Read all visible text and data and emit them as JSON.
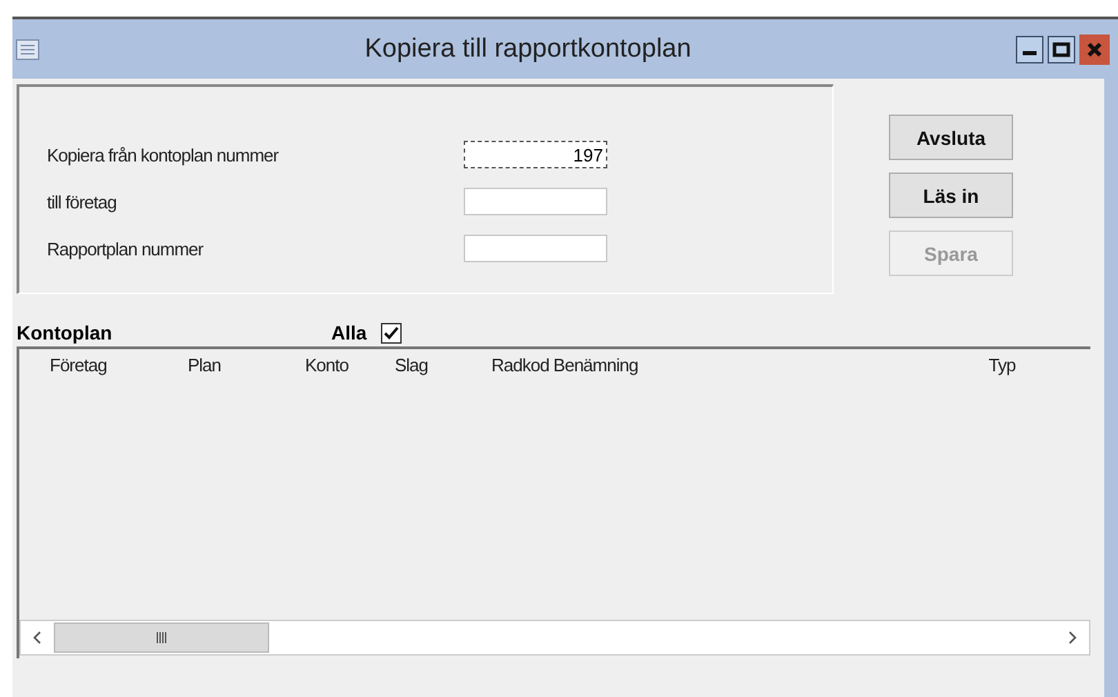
{
  "window": {
    "title": "Kopiera till rapportkontoplan"
  },
  "fields": [
    {
      "label": "Kopiera från kontoplan nummer",
      "value": "197"
    },
    {
      "label": "till företag"
    },
    {
      "label": "Rapportplan nummer"
    }
  ],
  "buttons": [
    {
      "label": "Avsluta",
      "disabled": false
    },
    {
      "label": "Läs in",
      "disabled": false
    },
    {
      "label": "Spara",
      "disabled": true
    }
  ],
  "list": {
    "title": "Kontoplan",
    "all": {
      "label": "Alla",
      "checked": true
    },
    "columns": [
      "Företag",
      "Plan",
      "Konto",
      "Slag",
      "Radkod Benämning",
      "Typ"
    ]
  }
}
